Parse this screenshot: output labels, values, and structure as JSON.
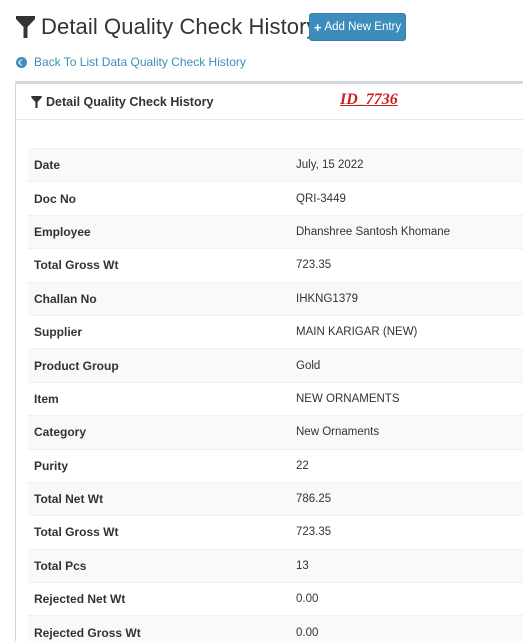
{
  "header": {
    "title": "Detail Quality Check History",
    "add_button_label": "Add New Entry"
  },
  "back_link": {
    "label": "Back To List Data Quality Check History"
  },
  "panel": {
    "title": "Detail Quality Check History",
    "record_id": "ID_7736"
  },
  "details": [
    {
      "label": "Date",
      "value": "July, 15 2022"
    },
    {
      "label": "Doc No",
      "value": "QRI-3449"
    },
    {
      "label": "Employee",
      "value": "Dhanshree Santosh Khomane"
    },
    {
      "label": "Total Gross Wt",
      "value": "723.35"
    },
    {
      "label": "Challan No",
      "value": "IHKNG1379"
    },
    {
      "label": "Supplier",
      "value": "MAIN KARIGAR (NEW)"
    },
    {
      "label": "Product Group",
      "value": "Gold"
    },
    {
      "label": "Item",
      "value": "NEW ORNAMENTS"
    },
    {
      "label": "Category",
      "value": "New Ornaments"
    },
    {
      "label": "Purity",
      "value": "22"
    },
    {
      "label": "Total Net Wt",
      "value": "786.25"
    },
    {
      "label": "Total Gross Wt",
      "value": "723.35"
    },
    {
      "label": "Total Pcs",
      "value": "13"
    },
    {
      "label": "Rejected Net Wt",
      "value": "0.00"
    },
    {
      "label": "Rejected Gross Wt",
      "value": "0.00"
    }
  ],
  "colors": {
    "primary": "#3c8dbc",
    "record_id": "#cc1f1f"
  }
}
